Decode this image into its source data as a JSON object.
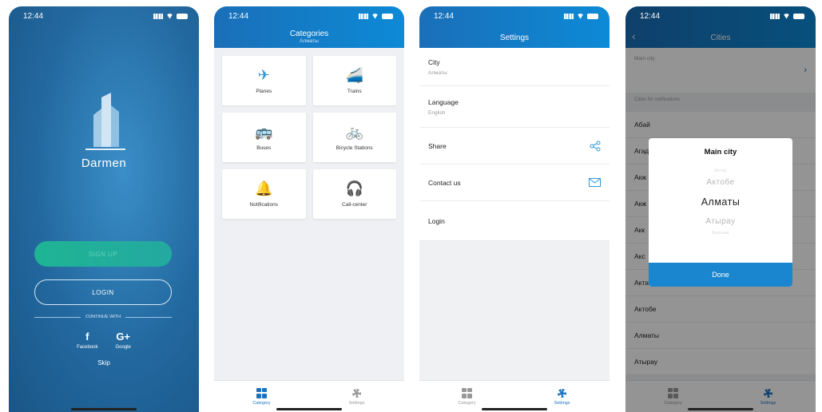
{
  "status_time": "12:44",
  "login": {
    "brand": "Darmen",
    "signup_label": "SIGN UP",
    "login_label": "LOGIN",
    "continue_label": "CONTINUE WITH",
    "facebook_glyph": "f",
    "facebook_label": "Facebook",
    "google_glyph": "G+",
    "google_label": "Google",
    "skip_label": "Skip"
  },
  "categories": {
    "title": "Categories",
    "subtitle": "Алматы",
    "items": [
      {
        "label": "Planes",
        "icon": "plane-icon",
        "glyph": "✈"
      },
      {
        "label": "Trains",
        "icon": "train-icon",
        "glyph": "🚄"
      },
      {
        "label": "Buses",
        "icon": "bus-icon",
        "glyph": "🚌"
      },
      {
        "label": "Bicycle Stations",
        "icon": "bicycle-icon",
        "glyph": "🚲"
      },
      {
        "label": "Notifications",
        "icon": "bell-icon",
        "glyph": "🔔"
      },
      {
        "label": "Call-center",
        "icon": "headset-icon",
        "glyph": "🎧"
      }
    ]
  },
  "settings": {
    "title": "Settings",
    "city_label": "City",
    "city_value": "Алматы",
    "language_label": "Language",
    "language_value": "English",
    "share_label": "Share",
    "contact_label": "Contact us",
    "login_label": "Login"
  },
  "cities": {
    "title": "Cities",
    "main_city_caption": "Main city",
    "notif_caption": "Cities for notifications",
    "list": [
      "Абай",
      "Агад",
      "Акж",
      "Акж",
      "Акк",
      "Акс",
      "Акта",
      "Актобе",
      "Алматы",
      "Атырау"
    ],
    "modal_title": "Main city",
    "wheel_prev2": "Актау",
    "wheel_prev": "Актобе",
    "wheel_selected": "Алматы",
    "wheel_next": "Атырау",
    "wheel_next2": "Балхаш",
    "done_label": "Done"
  },
  "tabs": {
    "category": "Category",
    "settings": "Settings"
  },
  "colors": {
    "accent": "#1a73c2",
    "signup_green": "#1fb494",
    "login_bg": "#22689f"
  }
}
